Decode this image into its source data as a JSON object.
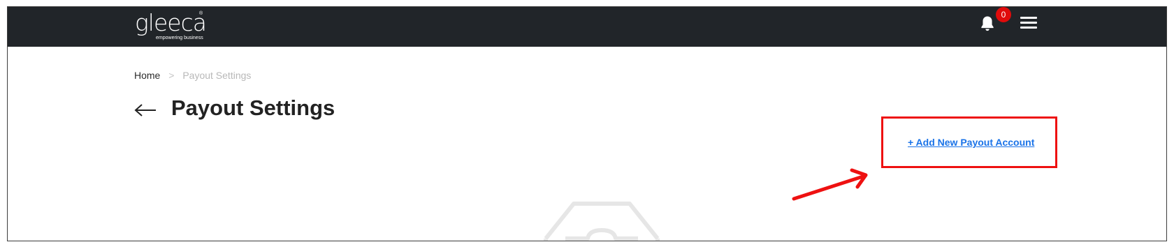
{
  "header": {
    "logo_text": "gleeca",
    "logo_tagline": "empowering business",
    "logo_registered": "®",
    "notification_count": "0",
    "icons": {
      "notifications": "bell-icon",
      "menu": "hamburger-menu-icon"
    }
  },
  "breadcrumb": {
    "home": "Home",
    "separator": ">",
    "current": "Payout Settings"
  },
  "page": {
    "title": "Payout Settings",
    "back_icon": "arrow-left-icon",
    "add_account_label": "+ Add New Payout Account",
    "empty_state_icon": "empty-inbox-icon"
  },
  "colors": {
    "navbar": "#212529",
    "link": "#1a73e8",
    "badge": "#e00b0b",
    "annotation": "#ee1111"
  }
}
